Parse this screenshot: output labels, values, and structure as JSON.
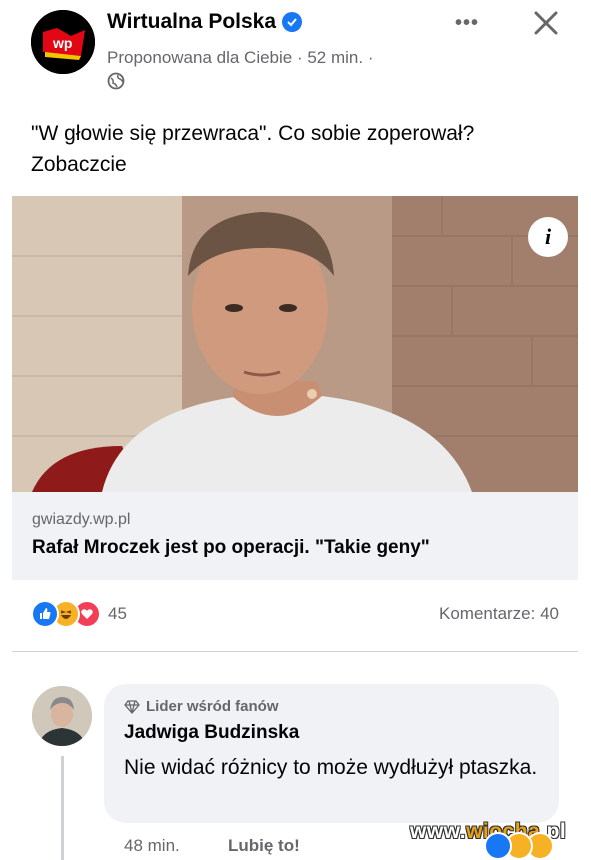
{
  "post": {
    "page_name": "Wirtualna Polska",
    "meta": "Proponowana dla Ciebie · 52 min. ·",
    "text": "\"W głowie się przewraca\". Co sobie zoperował? Zobaczcie"
  },
  "link": {
    "domain": "gwiazdy.wp.pl",
    "title": "Rafał Mroczek jest po operacji. \"Takie geny\""
  },
  "stats": {
    "reaction_count": "45",
    "comments": "Komentarze: 40",
    "reaction_icons": [
      "like-icon",
      "haha-icon",
      "love-icon"
    ]
  },
  "comment": {
    "badge": "Lider wśród fanów",
    "author": "Jadwiga Budzinska",
    "text": "Nie widać różnicy to może wydłużył ptaszka.",
    "time": "48 min.",
    "like_label": "Lubię to!"
  },
  "watermark": {
    "prefix": "www.",
    "accent": "wiocha",
    "suffix": ".pl"
  },
  "colors": {
    "accent": "#1877f2",
    "love": "#f33e58",
    "haha": "#f7b125"
  }
}
